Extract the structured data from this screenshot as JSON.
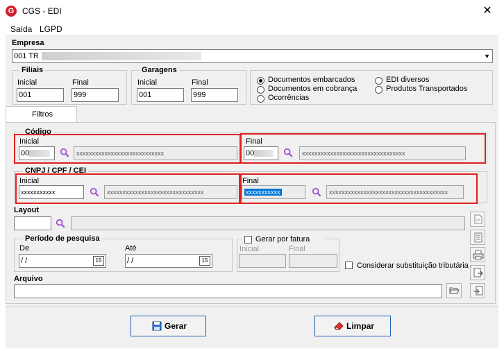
{
  "window": {
    "title": "CGS - EDI",
    "logo_letter": "G",
    "close": "✕"
  },
  "menu": {
    "items": [
      "Saída",
      "LGPD"
    ]
  },
  "empresa": {
    "label": "Empresa",
    "value": "001 TR"
  },
  "filiais": {
    "label": "Filiais",
    "inicial_label": "Inicial",
    "inicial_value": "001",
    "final_label": "Final",
    "final_value": "999"
  },
  "garagens": {
    "label": "Garagens",
    "inicial_label": "Inicial",
    "inicial_value": "001",
    "final_label": "Final",
    "final_value": "999"
  },
  "doc_options": [
    {
      "label": "Documentos embarcados",
      "selected": true
    },
    {
      "label": "Documentos em cobrança",
      "selected": false
    },
    {
      "label": "Ocorrências",
      "selected": false
    },
    {
      "label": "EDI diversos",
      "selected": false
    },
    {
      "label": "Produtos Transportados",
      "selected": false
    }
  ],
  "tab": {
    "label": "Filtros"
  },
  "codigo": {
    "label": "Código",
    "inicial_label": "Inicial",
    "inicial_value": "00",
    "inicial_desc": "xxxxxxxxxxxxxxxxxxxxxxxxxxxx",
    "final_label": "Final",
    "final_value": "00",
    "final_desc": "xxxxxxxxxxxxxxxxxxxxxxxxxxxxxxxxx"
  },
  "cnpj": {
    "label": "CNPJ / CPF / CEI",
    "inicial_label": "Inicial",
    "inicial_value": "xxxxxxxxxxx",
    "inicial_desc": "xxxxxxxxxxxxxxxxxxxxxxxxxxxxxxx",
    "final_label": "Final",
    "final_value": "xxxxxxxxxxx",
    "final_desc": "xxxxxxxxxxxxxxxxxxxxxxxxxxxxxxxxxxxxxx"
  },
  "layout": {
    "label": "Layout",
    "value": ""
  },
  "periodo": {
    "label": "Período de pesquisa",
    "de_label": "De",
    "de_value": " /  /",
    "ate_label": "Até",
    "ate_value": " /  /",
    "cal_text": "15"
  },
  "fatura": {
    "label": "Gerar por fatura",
    "inicial_label": "Inicial",
    "final_label": "Final"
  },
  "substituicao": {
    "label": "Considerar substituição tributária"
  },
  "arquivo": {
    "label": "Arquivo",
    "value": ""
  },
  "buttons": {
    "gerar": "Gerar",
    "limpar": "Limpar"
  },
  "colors": {
    "highlight": "#e02020",
    "selection": "#0078d7",
    "accent": "#1a5fb4",
    "search_icon": "#a050d0"
  }
}
